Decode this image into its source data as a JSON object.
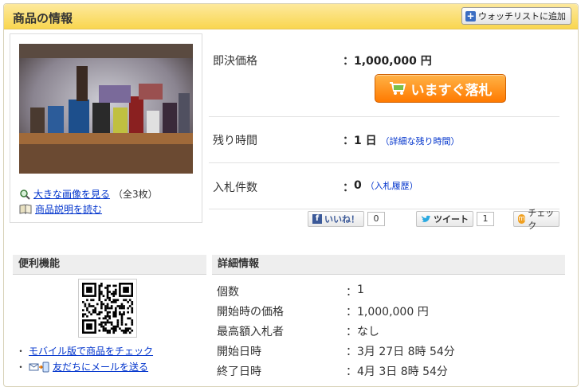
{
  "header": {
    "title": "商品の情報",
    "watch_button": "ウォッチリストに追加"
  },
  "image_panel": {
    "view_large": "大きな画像を見る",
    "image_count": "（全3枚）",
    "read_description": "商品説明を読む"
  },
  "info": {
    "buy_now_label": "即決価格",
    "colon": "：",
    "buy_now_price": "1,000,000 円",
    "buy_now_button": "いますぐ落札",
    "time_left_label": "残り時間",
    "time_left_value": "1 日",
    "time_left_link": "（詳細な残り時間）",
    "bids_label": "入札件数",
    "bids_value": "0",
    "bids_link": "（入札履歴）"
  },
  "social": {
    "like_label": "いいね！",
    "like_count": "0",
    "tweet_label": "ツイート",
    "tweet_count": "1",
    "check_label": "チェック"
  },
  "tools": {
    "title": "便利機能",
    "mobile_link": "モバイル版で商品をチェック",
    "mail_link": "友だちにメールを送る",
    "bullet": "・"
  },
  "details": {
    "title": "詳細情報",
    "rows": [
      {
        "label": "個数",
        "value": "1"
      },
      {
        "label": "開始時の価格",
        "value": "1,000,000 円"
      },
      {
        "label": "最高額入札者",
        "value": "なし"
      },
      {
        "label": "開始日時",
        "value": "3月 27日 8時 54分"
      },
      {
        "label": "終了日時",
        "value": "4月 3日 8時 54分"
      }
    ]
  },
  "colors": {
    "header_bg": "#f9d64f",
    "buy_button": "#ff7a00",
    "link": "#0033cc"
  }
}
